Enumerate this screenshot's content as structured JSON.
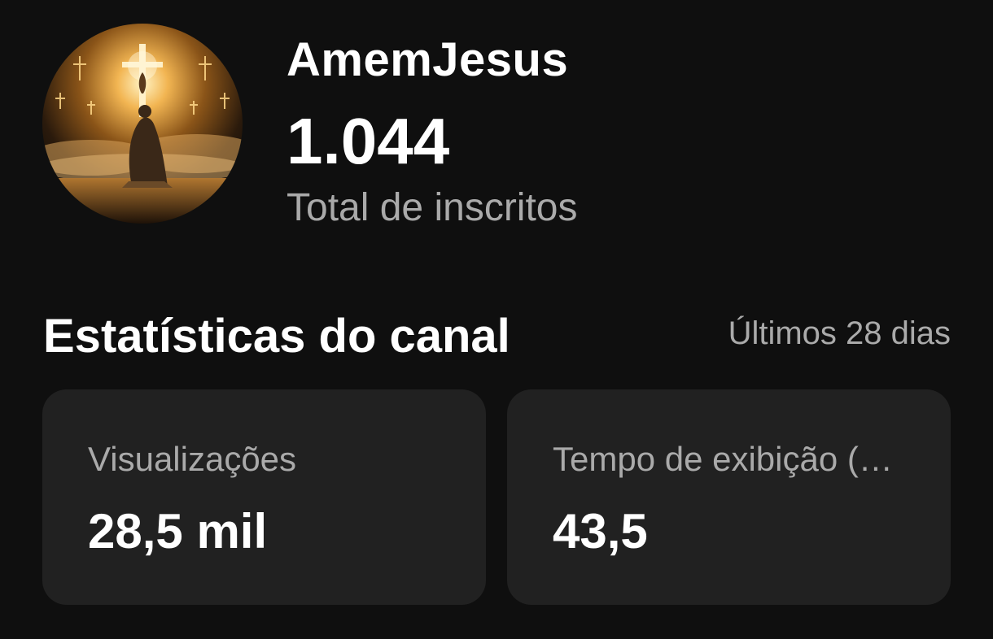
{
  "channel": {
    "avatar_icon": "channel-avatar-cross-image",
    "name": "AmemJesus",
    "subscriber_count": "1.044",
    "subscriber_label": "Total de inscritos"
  },
  "stats": {
    "title": "Estatísticas do canal",
    "period": "Últimos 28 dias",
    "cards": [
      {
        "label": "Visualizações",
        "value": "28,5 mil"
      },
      {
        "label": "Tempo de exibição (…",
        "value": "43,5"
      }
    ]
  },
  "colors": {
    "background": "#0f0f0f",
    "card_background": "#212121",
    "primary_text": "#ffffff",
    "secondary_text": "#aaaaaa"
  }
}
